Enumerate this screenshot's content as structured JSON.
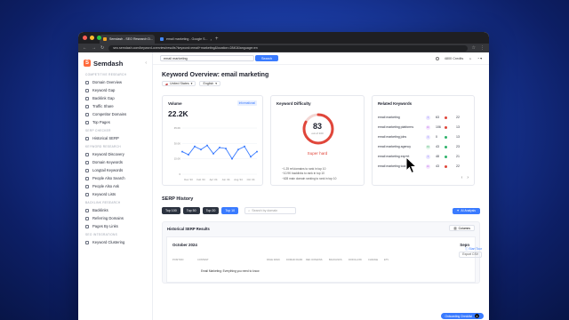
{
  "browser": {
    "tabs": [
      {
        "label": "Semdash - SEO Research D..."
      },
      {
        "label": "email marketing - Google S..."
      }
    ],
    "url": "seo.semdash.com/keyword-overview/results?keyword=email+marketing&location=2840&language=en"
  },
  "app": {
    "logo": "Semdash",
    "sidebar": {
      "sections": [
        {
          "label": "COMPETITIVE RESEARCH",
          "items": [
            "Domain Overview",
            "Keyword Gap",
            "Backlink Gap",
            "Traffic Share",
            "Competitor Domains",
            "Top Pages"
          ]
        },
        {
          "label": "SERP CHECKER",
          "items": [
            "Historical SERP"
          ]
        },
        {
          "label": "KEYWORD RESEARCH",
          "items": [
            "Keyword Discovery",
            "Domain Keywords",
            "Longtail Keywords",
            "People Also Search",
            "People Also Ask",
            "Keyword Lists"
          ]
        },
        {
          "label": "BACKLINK RESEARCH",
          "items": [
            "Backlinks",
            "Referring Domains",
            "Pages By Links"
          ]
        },
        {
          "label": "SEO INTEGRATIONS",
          "items": [
            "Keyword Clustering"
          ]
        }
      ]
    },
    "topbar": {
      "search_value": "email marketing",
      "search_button": "Search",
      "credits": "4800 Credits"
    }
  },
  "page": {
    "title": "Keyword Overview: email marketing",
    "country": "United States",
    "language": "English"
  },
  "volume": {
    "title": "Volume",
    "badge": "Informational",
    "value": "22.2K",
    "y_ticks": [
      "45.0K",
      "30.0K",
      "15.0K",
      "0"
    ],
    "x_ticks": [
      "Dec '23",
      "Feb '24",
      "Apr '24",
      "Jun '24",
      "Aug '24",
      "Oct '24"
    ]
  },
  "difficulty": {
    "title": "Keyword Difficulty",
    "value": "83",
    "sub": "out of 100",
    "score": 83,
    "label": "Super hard",
    "notes": [
      "~1.25 ref.domains to rank in top 10",
      "~10.9K backlinks to rank in top 10",
      "~628 main domain ranking to rank in top 10"
    ]
  },
  "related": {
    "title": "Related Keywords",
    "rows": [
      {
        "kw": "email marketing",
        "intent": "I",
        "vol": "63",
        "kd": "22",
        "dot": "#e0463a",
        "ibg": "#e9e5ff",
        "ifg": "#6a4cff"
      },
      {
        "kw": "email marketing platforms",
        "intent": "C",
        "vol": "106",
        "kd": "13",
        "dot": "#e0463a",
        "ibg": "#f5e4ff",
        "ifg": "#a240d8"
      },
      {
        "kw": "email marketing jobs",
        "intent": "I",
        "vol": "0",
        "kd": "13",
        "dot": "#2fb36b",
        "ibg": "#e9e5ff",
        "ifg": "#6a4cff"
      },
      {
        "kw": "email marketing agency",
        "intent": "N",
        "vol": "43",
        "kd": "23",
        "dot": "#2fb36b",
        "ibg": "#e1f5e8",
        "ifg": "#1c9a55"
      },
      {
        "kw": "email marketing expert",
        "intent": "I",
        "vol": "48",
        "kd": "21",
        "dot": "#2fb36b",
        "ibg": "#e9e5ff",
        "ifg": "#6a4cff"
      },
      {
        "kw": "email marketing tools",
        "intent": "C",
        "vol": "43",
        "kd": "22",
        "dot": "#e0463a",
        "ibg": "#f5e4ff",
        "ifg": "#a240d8"
      }
    ]
  },
  "serp": {
    "title": "SERP History",
    "buttons": [
      "Top 100",
      "Top 50",
      "Top 20",
      "Top 10"
    ],
    "search_placeholder": "Search by domain",
    "ai_button": "AI Analysis",
    "start_tour": "Start Tour",
    "export": "Export CSV",
    "panel_title": "Historical SERP Results",
    "columns_button": "Columns",
    "month": "October 2024",
    "month2": "Sepn",
    "headers": [
      "POSITION",
      "CONTENT",
      "PAGE RANK",
      "DOMAIN RANK",
      "REF. DOMAINS",
      "BACKLINKS",
      "DOFOLLOW",
      "CHANGE",
      "ETV"
    ],
    "first_cell": "Email Marketing: Everything you need to know",
    "onboarding": "Onboarding Checklist",
    "onboarding_count": "4"
  },
  "chart_data": {
    "type": "line",
    "title": "Volume",
    "x": [
      "Nov '23",
      "Dec '23",
      "Jan '24",
      "Feb '24",
      "Mar '24",
      "Apr '24",
      "May '24",
      "Jun '24",
      "Jul '24",
      "Aug '24",
      "Sep '24",
      "Oct '24",
      "Nov '24"
    ],
    "series": [
      {
        "values": [
          22000,
          19000,
          27000,
          24000,
          28000,
          20000,
          26000,
          25000,
          15000,
          24000,
          27000,
          17000,
          22000
        ]
      }
    ],
    "ylim": [
      0,
      45000
    ],
    "y_ticks": [
      "45.0K",
      "30.0K",
      "15.0K",
      "0"
    ],
    "x_ticks": [
      "Dec '23",
      "Feb '24",
      "Apr '24",
      "Jun '24",
      "Aug '24",
      "Oct '24"
    ],
    "grid": true,
    "color": "#3a7bff"
  }
}
